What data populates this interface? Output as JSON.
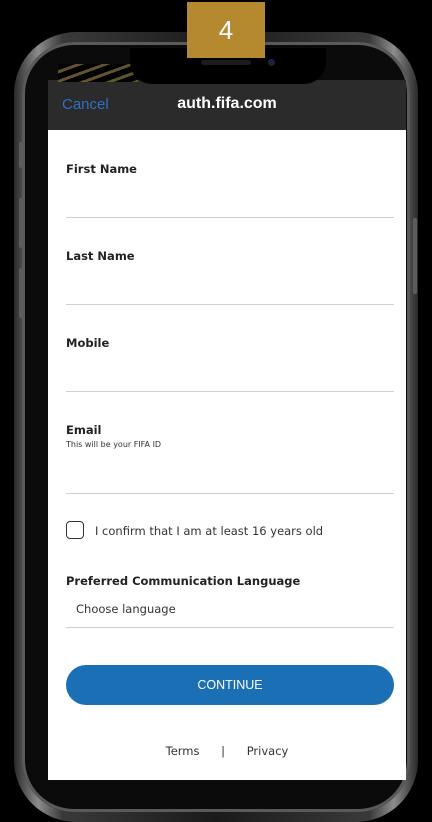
{
  "step_badge": "4",
  "nav": {
    "cancel_label": "Cancel",
    "title": "auth.fifa.com"
  },
  "form": {
    "first_name_label": "First Name",
    "last_name_label": "Last Name",
    "mobile_label": "Mobile",
    "email_label": "Email",
    "email_hint": "This will be your FIFA ID",
    "age_confirm_label": "I confirm that I am at least 16 years old",
    "language_label": "Preferred Communication Language",
    "language_value": "Choose language",
    "continue_label": "CONTINUE"
  },
  "footer": {
    "terms_label": "Terms",
    "separator": "|",
    "privacy_label": "Privacy"
  },
  "colors": {
    "badge": "#b58a2e",
    "nav_bg": "#2b2b2b",
    "link_blue": "#2e6fc4",
    "button_blue": "#1a6fb5"
  }
}
